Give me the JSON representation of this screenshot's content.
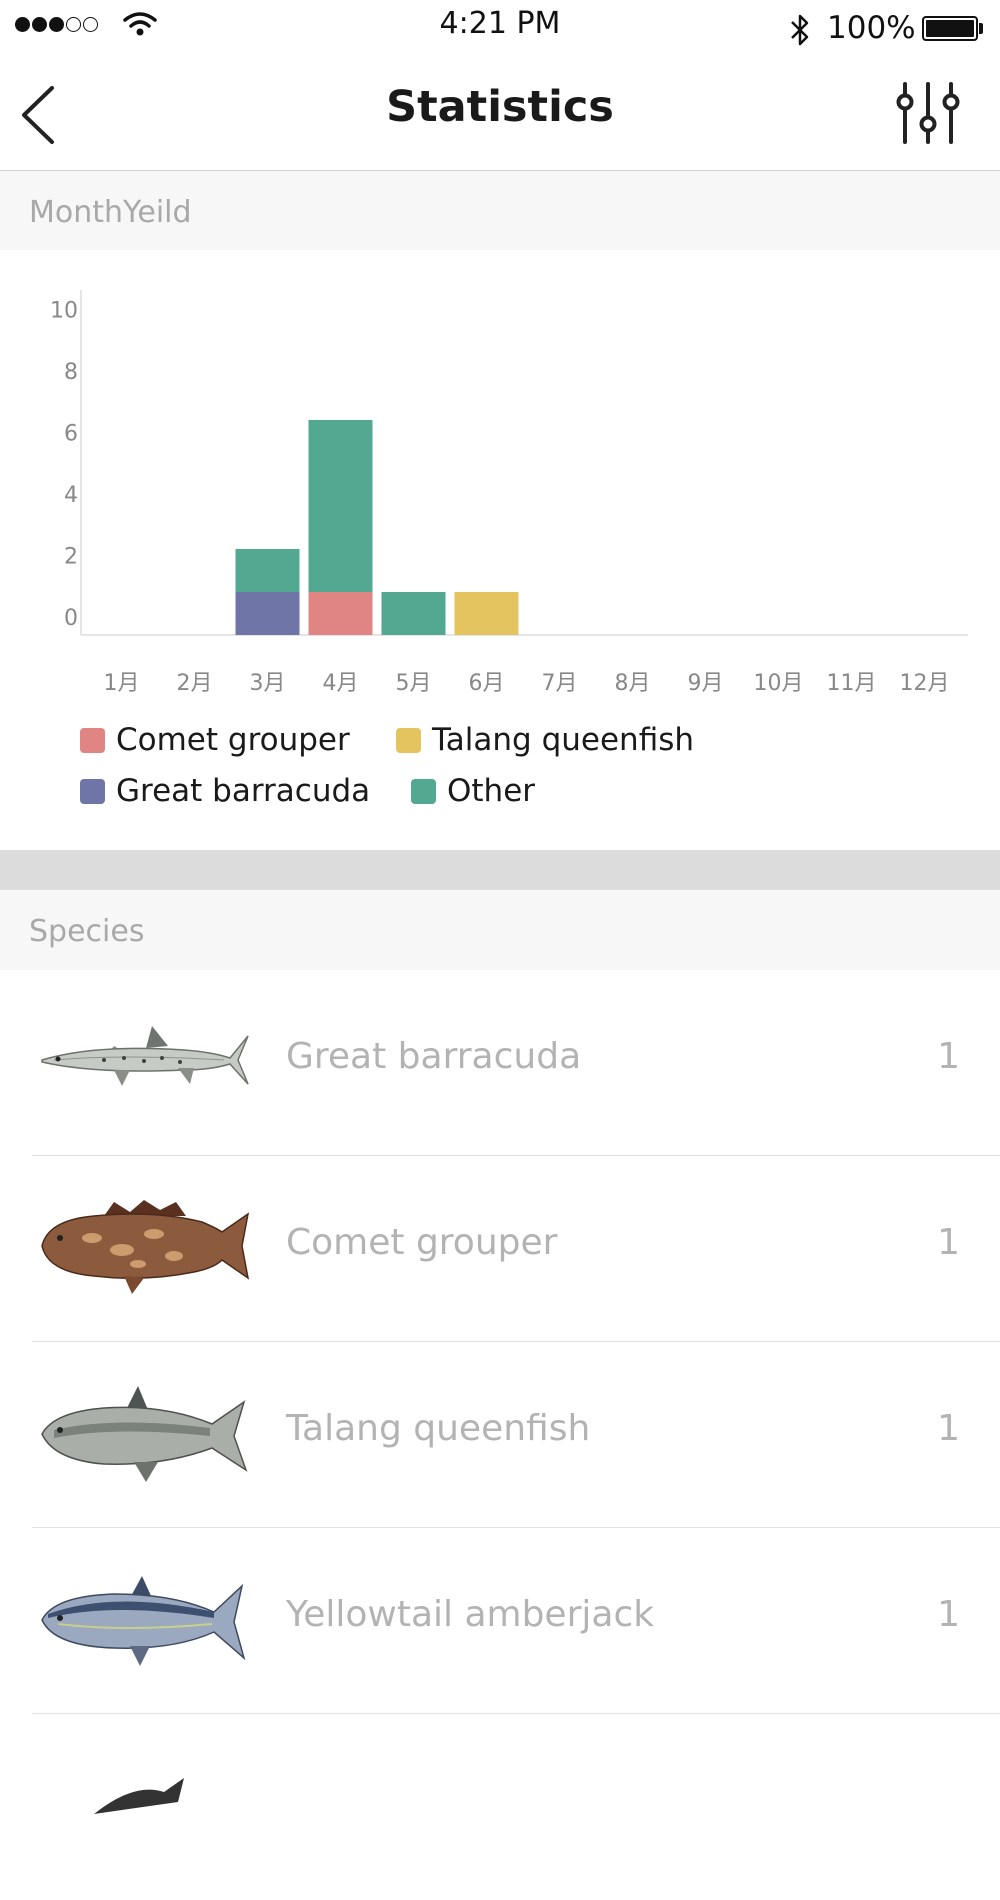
{
  "status_bar": {
    "time": "4:21 PM",
    "battery": "100%"
  },
  "nav": {
    "title": "Statistics"
  },
  "month_section": {
    "title": "MonthYeild"
  },
  "species_section": {
    "title": "Species"
  },
  "colors": {
    "comet_grouper": "#e08484",
    "talang_queenfish": "#e3c45f",
    "great_barracuda": "#6f75a7",
    "other": "#52a890"
  },
  "chart_data": {
    "type": "bar",
    "stacked": true,
    "categories": [
      "1月",
      "2月",
      "3月",
      "4月",
      "5月",
      "6月",
      "7月",
      "8月",
      "9月",
      "10月",
      "11月",
      "12月"
    ],
    "y_ticks": [
      "0",
      "2",
      "4",
      "6",
      "8",
      "10"
    ],
    "ylim": [
      0,
      10
    ],
    "grid": false,
    "legend_position": "bottom",
    "series": [
      {
        "name": "Comet grouper",
        "color": "#e08484",
        "values": [
          0,
          0,
          0,
          1,
          0,
          0,
          0,
          0,
          0,
          0,
          0,
          0
        ]
      },
      {
        "name": "Talang queenfish",
        "color": "#e3c45f",
        "values": [
          0,
          0,
          0,
          0,
          0,
          1,
          0,
          0,
          0,
          0,
          0,
          0
        ]
      },
      {
        "name": "Great barracuda",
        "color": "#6f75a7",
        "values": [
          0,
          0,
          1,
          0,
          0,
          0,
          0,
          0,
          0,
          0,
          0,
          0
        ]
      },
      {
        "name": "Other",
        "color": "#52a890",
        "values": [
          0,
          0,
          1,
          4,
          1,
          0,
          0,
          0,
          0,
          0,
          0,
          0
        ]
      }
    ]
  },
  "species": [
    {
      "name": "Great barracuda",
      "count": "1",
      "icon": "barracuda-image"
    },
    {
      "name": "Comet grouper",
      "count": "1",
      "icon": "grouper-image"
    },
    {
      "name": "Talang queenfish",
      "count": "1",
      "icon": "queenfish-image"
    },
    {
      "name": "Yellowtail amberjack",
      "count": "1",
      "icon": "amberjack-image"
    }
  ]
}
